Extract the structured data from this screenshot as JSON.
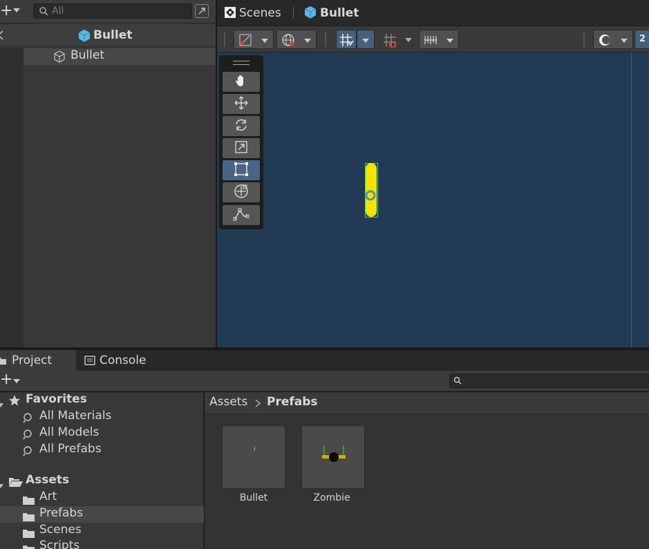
{
  "hierarchy": {
    "search_placeholder": "All",
    "header_title": "Bullet",
    "items": [
      {
        "label": "Bullet"
      }
    ]
  },
  "scene": {
    "breadcrumb_root": "Scenes",
    "breadcrumb_current": "Bullet",
    "zoom_label": "2"
  },
  "project": {
    "tabs": [
      {
        "label": "Project"
      },
      {
        "label": "Console"
      }
    ],
    "breadcrumb": [
      "Assets",
      "Prefabs"
    ],
    "favorites": {
      "label": "Favorites",
      "items": [
        {
          "label": "All Materials"
        },
        {
          "label": "All Models"
        },
        {
          "label": "All Prefabs"
        }
      ]
    },
    "assets": {
      "label": "Assets",
      "folders": [
        {
          "label": "Art"
        },
        {
          "label": "Prefabs"
        },
        {
          "label": "Scenes"
        },
        {
          "label": "Scripts"
        }
      ]
    },
    "grid_items": [
      {
        "label": "Bullet"
      },
      {
        "label": "Zombie"
      }
    ]
  },
  "colors": {
    "scene_background": "#223a53",
    "bullet_sprite": "#f0e400",
    "selection_outline": "#3fd08a",
    "active_button": "#46607c",
    "cube_icon": "#5cb8e6"
  }
}
